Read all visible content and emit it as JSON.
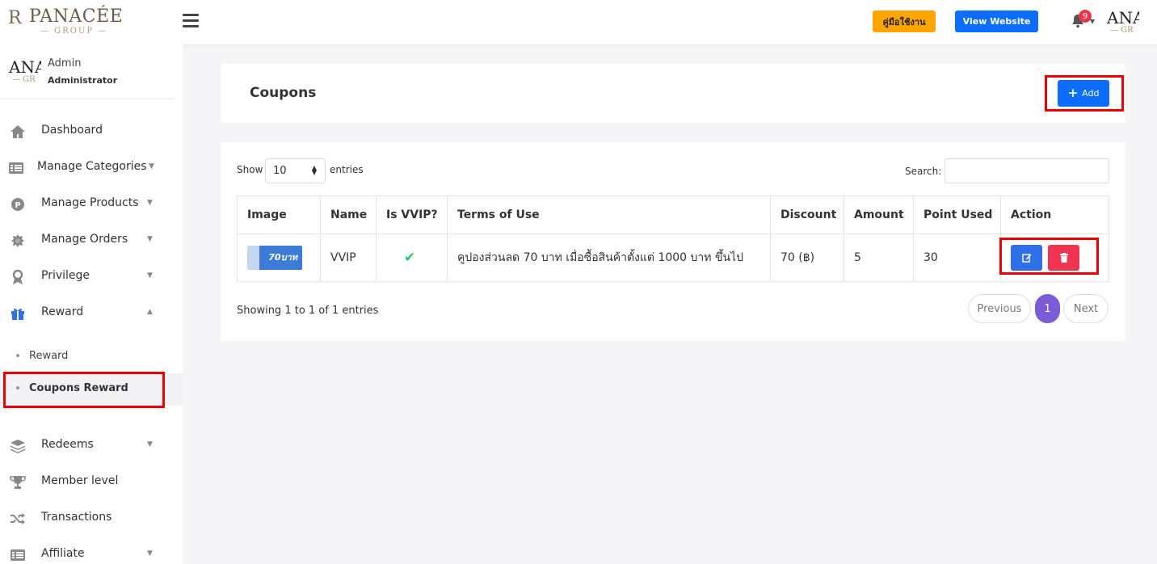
{
  "header": {
    "logo": {
      "mark": "R",
      "brand": "PANACÉE",
      "sub": "— GROUP —"
    },
    "manual_label": "คู่มือใช้งาน",
    "view_website_label": "View Website",
    "notification_count": "9",
    "avatar_text": "ANA",
    "avatar_sub": "— GR"
  },
  "sidebar": {
    "user": {
      "name": "Admin",
      "role": "Administrator",
      "avatar_text": "ANA",
      "avatar_sub": "— GR"
    },
    "items": [
      {
        "label": "Dashboard",
        "icon": "home-icon"
      },
      {
        "label": "Manage Categories",
        "icon": "list-icon",
        "has_submenu": true
      },
      {
        "label": "Manage Products",
        "icon": "product-icon",
        "has_submenu": true
      },
      {
        "label": "Manage Orders",
        "icon": "orders-icon",
        "has_submenu": true
      },
      {
        "label": "Privilege",
        "icon": "privilege-icon",
        "has_submenu": true
      },
      {
        "label": "Reward",
        "icon": "gift-icon",
        "has_submenu": true,
        "expanded": true
      },
      {
        "label": "Redeems",
        "icon": "layers-icon",
        "has_submenu": true
      },
      {
        "label": "Member level",
        "icon": "trophy-icon"
      },
      {
        "label": "Transactions",
        "icon": "shuffle-icon"
      },
      {
        "label": "Affiliate",
        "icon": "affiliate-icon",
        "has_submenu": true
      }
    ],
    "reward_submenu": [
      {
        "label": "Reward",
        "active": false
      },
      {
        "label": "Coupons Reward",
        "active": true
      }
    ]
  },
  "page": {
    "title": "Coupons",
    "add_label": "Add"
  },
  "table_controls": {
    "show_label": "Show",
    "page_size": "10",
    "entries_label": "entries",
    "search_label": "Search:",
    "search_value": ""
  },
  "table": {
    "columns": [
      "Image",
      "Name",
      "Is VVIP?",
      "Terms of Use",
      "Discount",
      "Amount",
      "Point Used",
      "Action"
    ],
    "rows": [
      {
        "image_text": "70บาท",
        "name": "VVIP",
        "is_vvip": true,
        "terms": "คูปองส่วนลด 70 บาท เมื่อซื้อสินค้าตั้งแต่ 1000 บาท ขึ้นไป",
        "discount": "70 (฿)",
        "amount": "5",
        "point_used": "30"
      }
    ]
  },
  "footer": {
    "showing_text": "Showing 1 to 1 of 1 entries",
    "previous_label": "Previous",
    "current_page": "1",
    "next_label": "Next"
  },
  "colors": {
    "primary": "#0d6efd",
    "manual_button": "#ffa500",
    "delete_button": "#f1344f",
    "edit_button": "#2f6fe8",
    "pagination_active": "#7b5cd6",
    "check": "#28c76f",
    "highlight": "#ee0000"
  }
}
